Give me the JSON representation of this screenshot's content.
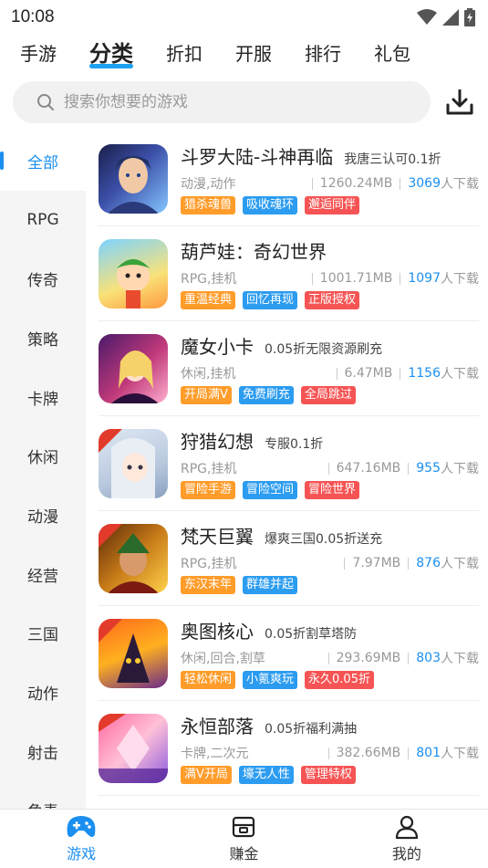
{
  "status_bar": {
    "time": "10:08"
  },
  "top_tabs": [
    {
      "label": "手游",
      "active": false
    },
    {
      "label": "分类",
      "active": true
    },
    {
      "label": "折扣",
      "active": false
    },
    {
      "label": "开服",
      "active": false
    },
    {
      "label": "排行",
      "active": false
    },
    {
      "label": "礼包",
      "active": false
    }
  ],
  "search": {
    "placeholder": "搜索你想要的游戏"
  },
  "sidebar": {
    "items": [
      {
        "label": "全部",
        "active": true
      },
      {
        "label": "RPG"
      },
      {
        "label": "传奇"
      },
      {
        "label": "策略"
      },
      {
        "label": "卡牌"
      },
      {
        "label": "休闲"
      },
      {
        "label": "动漫"
      },
      {
        "label": "经营"
      },
      {
        "label": "三国"
      },
      {
        "label": "动作"
      },
      {
        "label": "射击"
      },
      {
        "label": "角素"
      }
    ]
  },
  "download_suffix": "人下载",
  "games": [
    {
      "name": "斗罗大陆-斗神再临",
      "promo": "我唐三认可0.1折",
      "genre": "动漫,动作",
      "size": "1260.24MB",
      "downloads": "3069",
      "tags": [
        {
          "text": "猎杀魂兽",
          "color": "#ff9c2a"
        },
        {
          "text": "吸收魂环",
          "color": "#2c9cf0"
        },
        {
          "text": "邂逅同伴",
          "color": "#f65454"
        }
      ]
    },
    {
      "name": "葫芦娃：奇幻世界",
      "promo": "",
      "genre": "RPG,挂机",
      "size": "1001.71MB",
      "downloads": "1097",
      "tags": [
        {
          "text": "重温经典",
          "color": "#ff9c2a"
        },
        {
          "text": "回忆再现",
          "color": "#2c9cf0"
        },
        {
          "text": "正版授权",
          "color": "#f65454"
        }
      ]
    },
    {
      "name": "魔女小卡",
      "promo": "0.05折无限资源刷充",
      "genre": "休闲,挂机",
      "size": "6.47MB",
      "downloads": "1156",
      "tags": [
        {
          "text": "开局满V",
          "color": "#ff9c2a"
        },
        {
          "text": "免费刷充",
          "color": "#2c9cf0"
        },
        {
          "text": "全局跳过",
          "color": "#f65454"
        }
      ]
    },
    {
      "name": "狩猎幻想",
      "promo": "专服0.1折",
      "genre": "RPG,挂机",
      "size": "647.16MB",
      "downloads": "955",
      "tags": [
        {
          "text": "冒险手游",
          "color": "#ff9c2a"
        },
        {
          "text": "冒险空间",
          "color": "#2c9cf0"
        },
        {
          "text": "冒险世界",
          "color": "#f65454"
        }
      ]
    },
    {
      "name": "梵天巨翼",
      "promo": "爆爽三国0.05折送充",
      "genre": "RPG,挂机",
      "size": "7.97MB",
      "downloads": "876",
      "tags": [
        {
          "text": "东汉末年",
          "color": "#ff9c2a"
        },
        {
          "text": "群雄并起",
          "color": "#2c9cf0"
        }
      ]
    },
    {
      "name": "奥图核心",
      "promo": "0.05折割草塔防",
      "genre": "休闲,回合,割草",
      "size": "293.69MB",
      "downloads": "803",
      "tags": [
        {
          "text": "轻松休闲",
          "color": "#ff9c2a"
        },
        {
          "text": "小氪爽玩",
          "color": "#2c9cf0"
        },
        {
          "text": "永久0.05折",
          "color": "#f65454"
        }
      ]
    },
    {
      "name": "永恒部落",
      "promo": "0.05折福利满抽",
      "genre": "卡牌,二次元",
      "size": "382.66MB",
      "downloads": "801",
      "tags": [
        {
          "text": "满V开局",
          "color": "#ff9c2a"
        },
        {
          "text": "壕无人性",
          "color": "#2c9cf0"
        },
        {
          "text": "管理特权",
          "color": "#f65454"
        }
      ]
    }
  ],
  "bottom_nav": [
    {
      "label": "游戏",
      "icon": "gamepad-icon",
      "active": true
    },
    {
      "label": "赚金",
      "icon": "coin-box-icon"
    },
    {
      "label": "我的",
      "icon": "user-icon"
    }
  ],
  "colors": {
    "accent": "#1a8ff0",
    "tag_orange": "#ff9c2a",
    "tag_blue": "#2c9cf0",
    "tag_red": "#f65454"
  }
}
